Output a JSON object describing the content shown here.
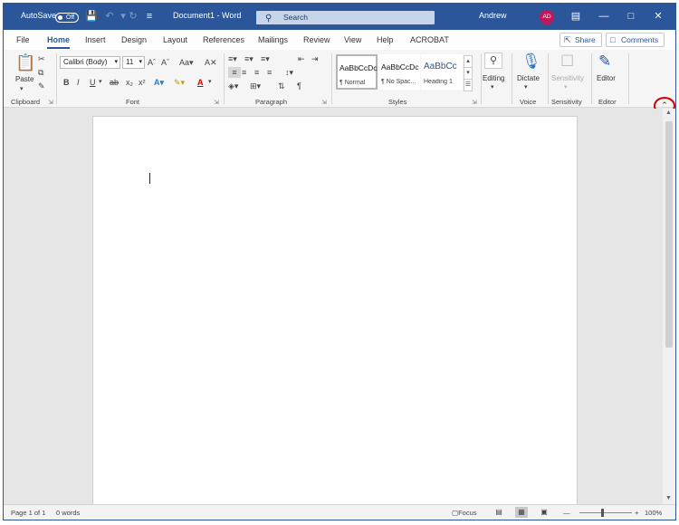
{
  "titlebar": {
    "autosave_label": "AutoSave",
    "autosave_state": "Off",
    "document_title": "Document1  -  Word",
    "search_placeholder": "Search",
    "user_name": "Andrew",
    "avatar_initials": "AD",
    "accent_color": "#2b579a"
  },
  "tabs": [
    "File",
    "Home",
    "Insert",
    "Design",
    "Layout",
    "References",
    "Mailings",
    "Review",
    "View",
    "Help",
    "ACROBAT"
  ],
  "active_tab": "Home",
  "actions": {
    "share": "Share",
    "comments": "Comments"
  },
  "ribbon": {
    "clipboard": {
      "label": "Clipboard",
      "paste": "Paste"
    },
    "font": {
      "label": "Font",
      "font_name": "Calibri (Body)",
      "font_size": "11",
      "case_label": "Aa",
      "bold": "B",
      "italic": "I",
      "underline": "U",
      "strike": "ab",
      "sub": "x₂",
      "sup": "x²"
    },
    "paragraph": {
      "label": "Paragraph",
      "pilcrow": "¶"
    },
    "styles": {
      "label": "Styles",
      "items": [
        {
          "sample": "AaBbCcDc",
          "name": "¶ Normal"
        },
        {
          "sample": "AaBbCcDc",
          "name": "¶ No Spac..."
        },
        {
          "sample": "AaBbCc",
          "name": "Heading 1"
        }
      ]
    },
    "editing": {
      "label": "Editing"
    },
    "voice": {
      "label": "Voice",
      "dictate": "Dictate"
    },
    "sensitivity": {
      "label": "Sensitivity",
      "button": "Sensitivity"
    },
    "editor": {
      "label": "Editor",
      "button": "Editor"
    }
  },
  "status": {
    "page": "Page 1 of 1",
    "words": "0 words",
    "focus": "Focus",
    "zoom": "100%"
  }
}
